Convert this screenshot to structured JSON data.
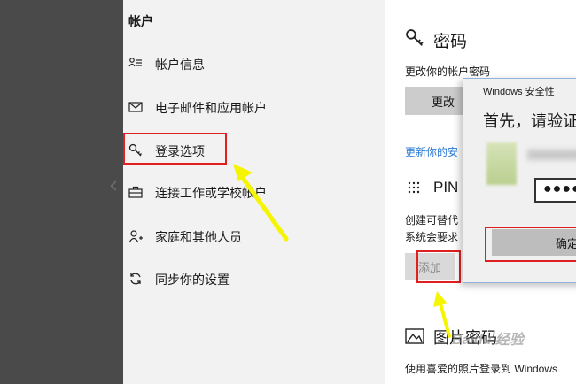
{
  "sidebar": {
    "title": "帐户",
    "items": [
      {
        "label": "帐户信息",
        "icon": "person-card-icon"
      },
      {
        "label": "电子邮件和应用帐户",
        "icon": "mail-icon"
      },
      {
        "label": "登录选项",
        "icon": "key-icon"
      },
      {
        "label": "连接工作或学校帐户",
        "icon": "briefcase-icon"
      },
      {
        "label": "家庭和其他人员",
        "icon": "person-add-icon"
      },
      {
        "label": "同步你的设置",
        "icon": "sync-icon"
      }
    ]
  },
  "main": {
    "password": {
      "title": "密码",
      "desc": "更改你的帐户密码",
      "button": "更改",
      "update_link": "更新你的安"
    },
    "pin": {
      "title": "PIN",
      "desc1": "创建可替代",
      "desc2": "系统会要求",
      "button": "添加"
    },
    "picture": {
      "title": "图片密码",
      "desc": "使用喜爱的照片登录到 Windows"
    }
  },
  "dialog": {
    "window_title": "Windows 安全性",
    "heading": "首先，请验证",
    "pin_value": "●●●●●",
    "ok_button": "确定"
  },
  "watermark": "Baidu 经验",
  "colors": {
    "highlight": "#e02020",
    "arrow": "#f5f500",
    "link": "#2b7bd6"
  }
}
